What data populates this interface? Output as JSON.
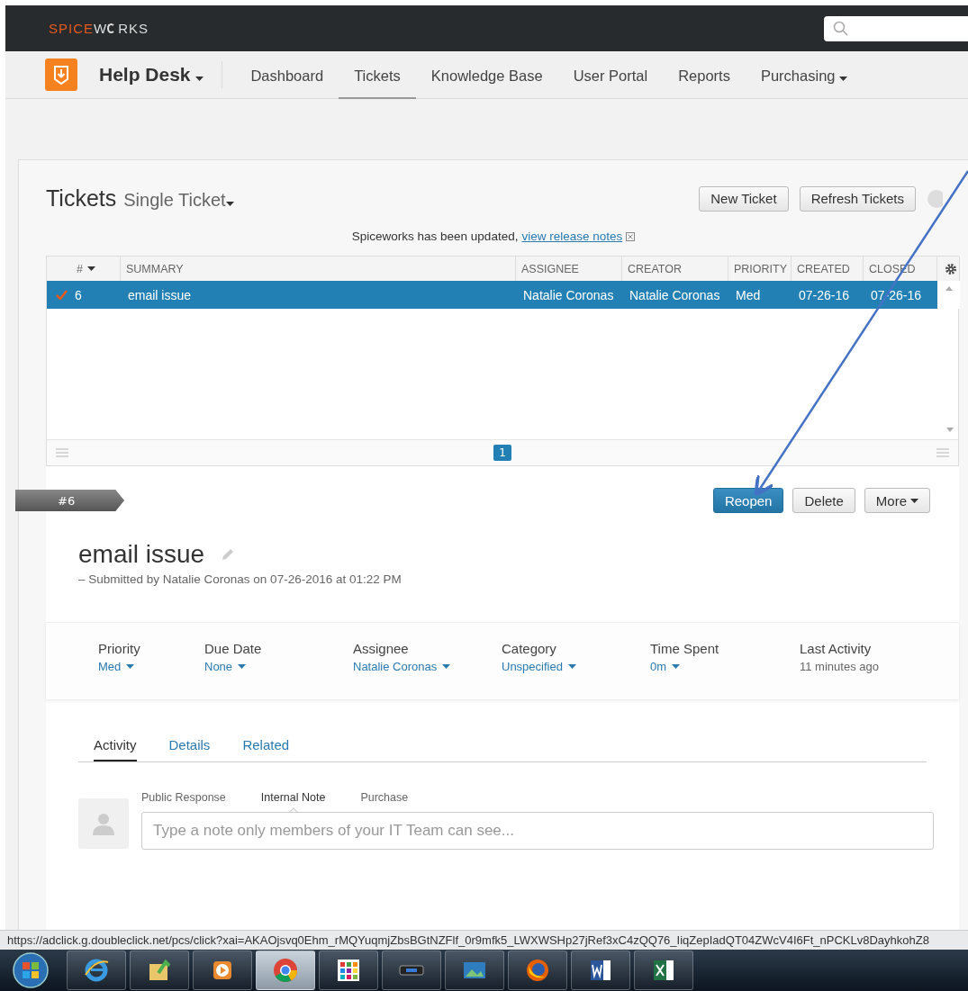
{
  "topbar": {
    "logo": {
      "part_1": "SPICE",
      "part_2": "W",
      "part_3": "RKS"
    }
  },
  "nav": {
    "app_title": "Help Desk",
    "items": [
      {
        "label": "Dashboard",
        "selected": false,
        "dropdown": false
      },
      {
        "label": "Tickets",
        "selected": true,
        "dropdown": false
      },
      {
        "label": "Knowledge Base",
        "selected": false,
        "dropdown": false
      },
      {
        "label": "User Portal",
        "selected": false,
        "dropdown": false
      },
      {
        "label": "Reports",
        "selected": false,
        "dropdown": false
      },
      {
        "label": "Purchasing",
        "selected": false,
        "dropdown": true
      }
    ]
  },
  "header": {
    "title": "Tickets",
    "view": "Single Ticket",
    "buttons": [
      "New Ticket",
      "Refresh Tickets"
    ]
  },
  "notice": {
    "text": "Spiceworks has been updated,",
    "link": "view release notes"
  },
  "table": {
    "columns": [
      "#",
      "SUMMARY",
      "ASSIGNEE",
      "CREATOR",
      "PRIORITY",
      "CREATED",
      "CLOSED"
    ],
    "rows": [
      {
        "selected": true,
        "closed": true,
        "cells": [
          "6",
          "email issue",
          "Natalie Coronas",
          "Natalie Coronas",
          "Med",
          "07-26-16",
          "07-26-16"
        ]
      }
    ],
    "pages": [
      {
        "label": "1",
        "selected": true
      }
    ]
  },
  "ticket": {
    "tag": "#6",
    "actions": [
      {
        "label": "Reopen",
        "kind": "primary"
      },
      {
        "label": "Delete",
        "kind": "plain"
      },
      {
        "label": "More",
        "kind": "menu"
      }
    ],
    "title": "email issue",
    "submitted": "– Submitted by Natalie Coronas on 07-26-2016 at 01:22 PM",
    "fields": [
      {
        "label": "Priority",
        "value": "Med",
        "kind": "dropdown"
      },
      {
        "label": "Due Date",
        "value": "None",
        "kind": "dropdown"
      },
      {
        "label": "Assignee",
        "value": "Natalie Coronas",
        "kind": "dropdown"
      },
      {
        "label": "Category",
        "value": "Unspecified",
        "kind": "dropdown"
      },
      {
        "label": "Time Spent",
        "value": "0m",
        "kind": "dropdown"
      },
      {
        "label": "Last Activity",
        "value": "11 minutes ago",
        "kind": "text"
      }
    ],
    "tabs": [
      {
        "label": "Activity",
        "selected": true
      },
      {
        "label": "Details",
        "selected": false
      },
      {
        "label": "Related",
        "selected": false
      }
    ],
    "note_tabs": [
      {
        "label": "Public Response",
        "selected": false
      },
      {
        "label": "Internal Note",
        "selected": true
      },
      {
        "label": "Purchase",
        "selected": false
      }
    ],
    "note": {
      "placeholder": "Type a note only members of your IT Team can see..."
    }
  },
  "status_url": "https://adclick.g.doubleclick.net/pcs/click?xai=AKAOjsvq0Ehm_rMQYuqmjZbsBGtNZFlf_0r9mfk5_LWXWSHp27jRef3xC4zQQ76_IiqZepIadQT04ZWcV4I6Ft_nPCKLv8DayhkohZ8",
  "taskbar": {
    "apps": [
      {
        "kind": "ie",
        "selected": false
      },
      {
        "kind": "folder",
        "selected": false
      },
      {
        "kind": "media",
        "selected": false
      },
      {
        "kind": "chrome",
        "selected": true
      },
      {
        "kind": "tiles",
        "selected": false
      },
      {
        "kind": "device",
        "selected": false
      },
      {
        "kind": "photo",
        "selected": false
      },
      {
        "kind": "firefox",
        "selected": false
      },
      {
        "kind": "word",
        "selected": false
      },
      {
        "kind": "excel",
        "selected": false
      }
    ]
  }
}
